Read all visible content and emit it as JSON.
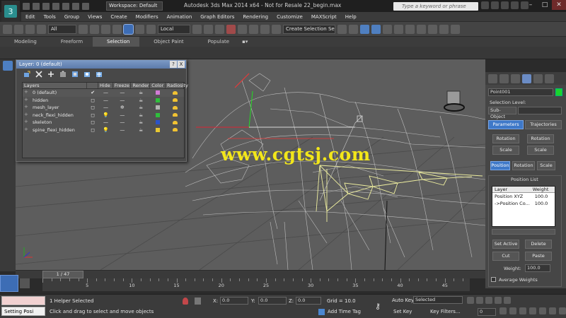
{
  "window": {
    "workspace": "Workspace: Default",
    "title": "Autodesk 3ds Max  2014 x64   - Not for Resale    22_begin.max",
    "search_placeholder": "Type a keyword or phrase"
  },
  "menu": [
    "Edit",
    "Tools",
    "Group",
    "Views",
    "Create",
    "Modifiers",
    "Animation",
    "Graph Editors",
    "Rendering",
    "Customize",
    "MAXScript",
    "Help"
  ],
  "toolbar": {
    "filter": "All",
    "coord": "Local",
    "selection_set": "Create Selection Se"
  },
  "ribbon": {
    "tabs": [
      "Modeling",
      "Freeform",
      "Selection",
      "Object Paint",
      "Populate"
    ],
    "active": "Selection"
  },
  "layer_dialog": {
    "title": "Layer: 0 (default)",
    "help": "?",
    "close": "X",
    "columns": [
      "Layers",
      "Hide",
      "Freeze",
      "Render",
      "Color",
      "Radiosity"
    ],
    "rows": [
      {
        "name": "0 (default)",
        "check": "✔",
        "hide": "—",
        "freeze": "—",
        "render": "☕",
        "color": "#d27bd6"
      },
      {
        "name": "hidden",
        "check": "◻",
        "hide": "—",
        "freeze": "—",
        "render": "☕",
        "color": "#2fbf3c"
      },
      {
        "name": "mesh_layer",
        "check": "◻",
        "hide": "—",
        "freeze": "✲",
        "render": "☕",
        "color": "#b4b4b4"
      },
      {
        "name": "neck_flexi_hidden",
        "check": "◻",
        "hide": "💡",
        "freeze": "—",
        "render": "☕",
        "color": "#2fbf3c"
      },
      {
        "name": "skeleton",
        "check": "◻",
        "hide": "—",
        "freeze": "—",
        "render": "☕",
        "color": "#2b53c9"
      },
      {
        "name": "spine_flexi_hidden",
        "check": "◻",
        "hide": "💡",
        "freeze": "—",
        "render": "☕",
        "color": "#e8c832"
      }
    ]
  },
  "watermark": "www.cgtsj.com",
  "command_panel": {
    "object_name": "Point001",
    "selection_level_label": "Selection Level:",
    "sub_object": "Sub-Object",
    "tab_parameters": "Parameters",
    "tab_trajectories": "Trajectories",
    "btn_rotation_a": "Rotation",
    "btn_rotation_b": "Rotation",
    "btn_scale_a": "Scale",
    "btn_scale_b": "Scale",
    "btn_position": "Position",
    "btn_rotation_c": "Rotation",
    "btn_scale_c": "Scale",
    "position_list_title": "Position List",
    "list_headers": [
      "Layer",
      "Weight"
    ],
    "list_rows": [
      {
        "layer": "Position XYZ",
        "weight": "100.0"
      },
      {
        "layer": "->Position Co...",
        "weight": "100.0"
      }
    ],
    "set_active": "Set Active",
    "delete": "Delete",
    "cut": "Cut",
    "paste": "Paste",
    "weight_label": "Weight:",
    "weight_value": "100.0",
    "average_weights": "Average Weights"
  },
  "timeline": {
    "slider": "1 / 47",
    "ticks": [
      "5",
      "10",
      "15",
      "20",
      "25",
      "30",
      "35",
      "40",
      "45"
    ]
  },
  "status": {
    "listener": "Setting Posi",
    "selected": "1 Helper Selected",
    "prompt": "Click and drag to select and move objects",
    "x_label": "X:",
    "x_value": "0.0",
    "y_label": "Y:",
    "y_value": "0.0",
    "z_label": "Z:",
    "z_value": "0.0",
    "grid": "Grid = 10.0",
    "add_time_tag": "Add Time Tag",
    "auto_key": "Auto Key",
    "set_key": "Set Key",
    "key_mode": "Selected",
    "key_filters": "Key Filters...",
    "frame": "0"
  },
  "colors": {
    "accent": "#3d6db5",
    "watermark": "#f2e61a",
    "trajectory": "#f0f0a0"
  }
}
